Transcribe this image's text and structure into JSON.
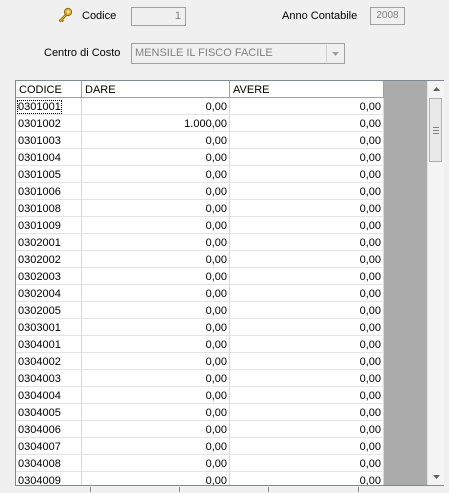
{
  "header": {
    "codice_label": "Codice",
    "codice_value": "1",
    "anno_label": "Anno Contabile",
    "anno_value": "2008",
    "centro_label": "Centro di Costo",
    "centro_value": "MENSILE IL FISCO FACILE"
  },
  "icons": {
    "key": "key-icon",
    "dropdown": "chevron-down-icon"
  },
  "grid": {
    "columns": [
      "CODICE",
      "DARE",
      "AVERE"
    ],
    "rows": [
      [
        "0301001",
        "0,00",
        "0,00"
      ],
      [
        "0301002",
        "1.000,00",
        "0,00"
      ],
      [
        "0301003",
        "0,00",
        "0,00"
      ],
      [
        "0301004",
        "0,00",
        "0,00"
      ],
      [
        "0301005",
        "0,00",
        "0,00"
      ],
      [
        "0301006",
        "0,00",
        "0,00"
      ],
      [
        "0301008",
        "0,00",
        "0,00"
      ],
      [
        "0301009",
        "0,00",
        "0,00"
      ],
      [
        "0302001",
        "0,00",
        "0,00"
      ],
      [
        "0302002",
        "0,00",
        "0,00"
      ],
      [
        "0302003",
        "0,00",
        "0,00"
      ],
      [
        "0302004",
        "0,00",
        "0,00"
      ],
      [
        "0302005",
        "0,00",
        "0,00"
      ],
      [
        "0303001",
        "0,00",
        "0,00"
      ],
      [
        "0304001",
        "0,00",
        "0,00"
      ],
      [
        "0304002",
        "0,00",
        "0,00"
      ],
      [
        "0304003",
        "0,00",
        "0,00"
      ],
      [
        "0304004",
        "0,00",
        "0,00"
      ],
      [
        "0304005",
        "0,00",
        "0,00"
      ],
      [
        "0304006",
        "0,00",
        "0,00"
      ],
      [
        "0304007",
        "0,00",
        "0,00"
      ],
      [
        "0304008",
        "0,00",
        "0,00"
      ],
      [
        "0304009",
        "0,00",
        "0,00"
      ]
    ]
  },
  "colors": {
    "grid_background": "#ababab",
    "window": "#f0f0f0",
    "disabled_text": "#808080"
  }
}
